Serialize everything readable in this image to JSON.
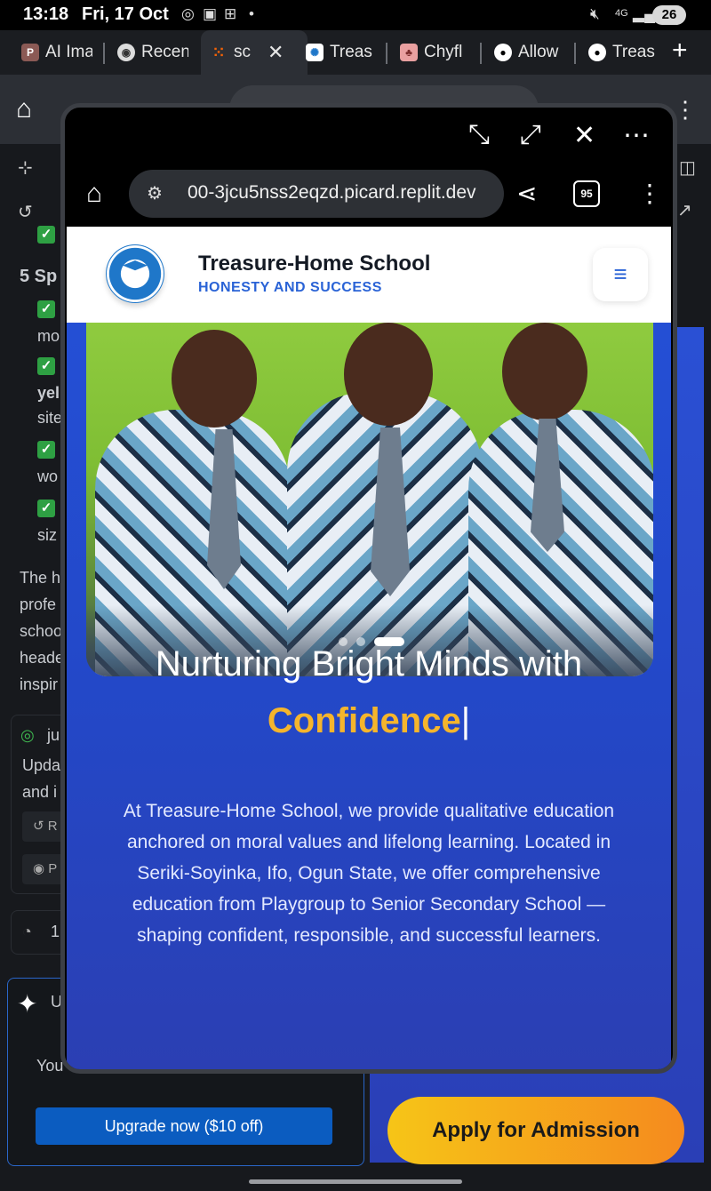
{
  "status_bar": {
    "time": "13:18",
    "date": "Fri, 17 Oct",
    "battery": "26"
  },
  "tabs": [
    {
      "label": "AI Ima",
      "icon": "p-icon"
    },
    {
      "label": "Recen",
      "icon": "chrome-icon"
    },
    {
      "label": "sc",
      "icon": "replit-icon",
      "active": true
    },
    {
      "label": "Treas",
      "icon": "school-icon"
    },
    {
      "label": "Chyfl",
      "icon": "cake-icon"
    },
    {
      "label": "Allow",
      "icon": "github-icon"
    },
    {
      "label": "Treas",
      "icon": "github-icon"
    }
  ],
  "background": {
    "section_title": "5 Sp",
    "items": [
      "mo",
      "yel",
      "site",
      "wo",
      "siz"
    ],
    "para_lines": [
      "The h",
      "profe",
      "schoo",
      "heade",
      "inspir"
    ],
    "card_user": "ju",
    "card_lines": [
      "Upda",
      "and i"
    ],
    "card_btns": [
      "R",
      "P"
    ],
    "counter": "1",
    "upgrade_head": "U",
    "upgrade_text": "You",
    "upgrade_btn": "Upgrade now ($10 off)",
    "apply_btn": "Apply for Admission"
  },
  "popup": {
    "url": "00-3jcu5nss2eqzd.picard.replit.dev",
    "tab_count": "95"
  },
  "site": {
    "name": "Treasure-Home School",
    "motto": "HONESTY AND SUCCESS",
    "heading_line1": "Nurturing Bright Minds with",
    "heading_line2": "Confidence",
    "paragraph": "At Treasure-Home School, we provide qualitative education anchored on moral values and lifelong learning. Located in Seriki-Soyinka, Ifo, Ogun State, we offer comprehensive education from Playgroup to Senior Secondary School — shaping confident, responsible, and successful learners.",
    "carousel_active": 3,
    "carousel_total": 3
  },
  "colors": {
    "accent": "#2a63d6",
    "hero_bg": "#2451d8",
    "highlight": "#f5b52c",
    "apply_gradient_start": "#f6c517",
    "apply_gradient_end": "#f58a1e"
  }
}
